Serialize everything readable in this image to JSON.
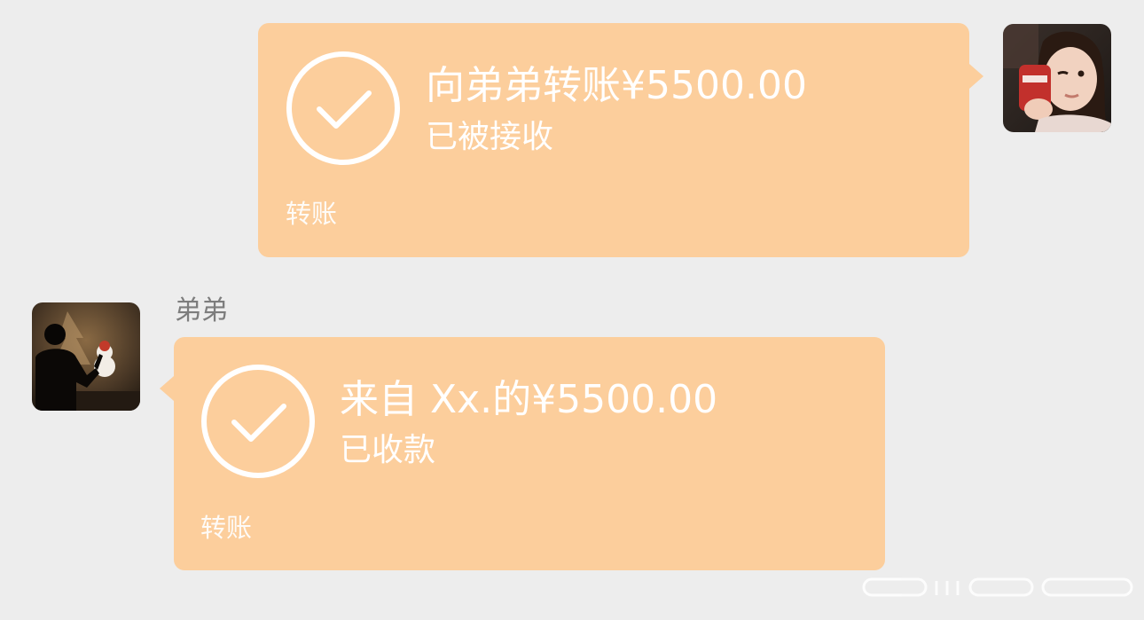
{
  "messages": [
    {
      "direction": "outgoing",
      "title": "向弟弟转账¥5500.00",
      "status": "已被接收",
      "footer": "转账",
      "avatar_icon": "girl-avatar"
    },
    {
      "direction": "incoming",
      "sender": "弟弟",
      "title": "来自 Xx.的¥5500.00",
      "status": "已收款",
      "footer": "转账",
      "avatar_icon": "person-avatar"
    }
  ],
  "colors": {
    "background": "#ededed",
    "bubble": "#fcce9c",
    "text": "#ffffff",
    "sender_name": "#7d7d7d"
  }
}
